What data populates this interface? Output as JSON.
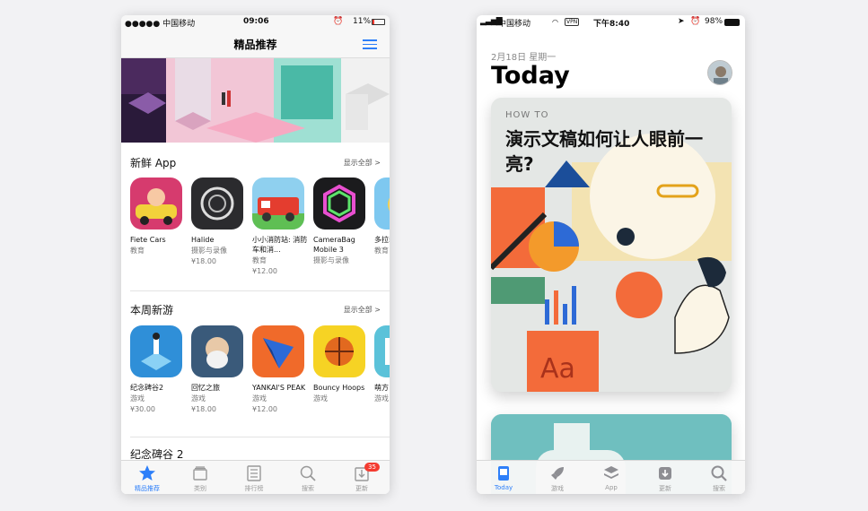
{
  "left": {
    "status": {
      "carrier": "●●●●● 中国移动",
      "time": "09:06",
      "battery": "11%"
    },
    "nav": {
      "title": "精品推荐"
    },
    "sections": [
      {
        "title": "新鲜 App",
        "more": "显示全部 >",
        "apps": [
          {
            "name": "Fiete Cars",
            "category": "教育",
            "price": ""
          },
          {
            "name": "Halide",
            "category": "摄影与录像",
            "price": "¥18.00"
          },
          {
            "name": "小小消防站: 消防车和消...",
            "category": "教育",
            "price": "¥12.00"
          },
          {
            "name": "CameraBag Mobile 3",
            "category": "摄影与录像",
            "price": ""
          },
          {
            "name": "多拉动画",
            "category": "教育",
            "price": ""
          }
        ]
      },
      {
        "title": "本周新游",
        "more": "显示全部 >",
        "apps": [
          {
            "name": "纪念碑谷2",
            "category": "游戏",
            "price": "¥30.00"
          },
          {
            "name": "回忆之旅",
            "category": "游戏",
            "price": "¥18.00"
          },
          {
            "name": "YANKAI'S PEAK",
            "category": "游戏",
            "price": "¥12.00"
          },
          {
            "name": "Bouncy Hoops",
            "category": "游戏",
            "price": ""
          },
          {
            "name": "萌方",
            "category": "游戏",
            "price": ""
          }
        ]
      },
      {
        "title": "纪念碑谷 2"
      }
    ],
    "tabs": [
      {
        "label": "精品推荐",
        "icon": "star-icon"
      },
      {
        "label": "类别",
        "icon": "categories-icon"
      },
      {
        "label": "排行榜",
        "icon": "charts-icon"
      },
      {
        "label": "搜索",
        "icon": "search-icon"
      },
      {
        "label": "更新",
        "icon": "updates-icon",
        "badge": "35"
      }
    ],
    "accent": "#2d7ff9"
  },
  "right": {
    "status": {
      "carrier": "中国移动",
      "vpn": "VPN",
      "time": "下午8:40",
      "battery": "98%"
    },
    "date": "2月18日 星期一",
    "heading": "Today",
    "card": {
      "kicker": "HOW TO",
      "title": "演示文稿如何让人眼前一亮?"
    },
    "tabs": [
      {
        "label": "Today",
        "icon": "today-icon"
      },
      {
        "label": "游戏",
        "icon": "rocket-icon"
      },
      {
        "label": "App",
        "icon": "app-stack-icon"
      },
      {
        "label": "更新",
        "icon": "updates-icon"
      },
      {
        "label": "搜索",
        "icon": "search-icon"
      }
    ]
  }
}
